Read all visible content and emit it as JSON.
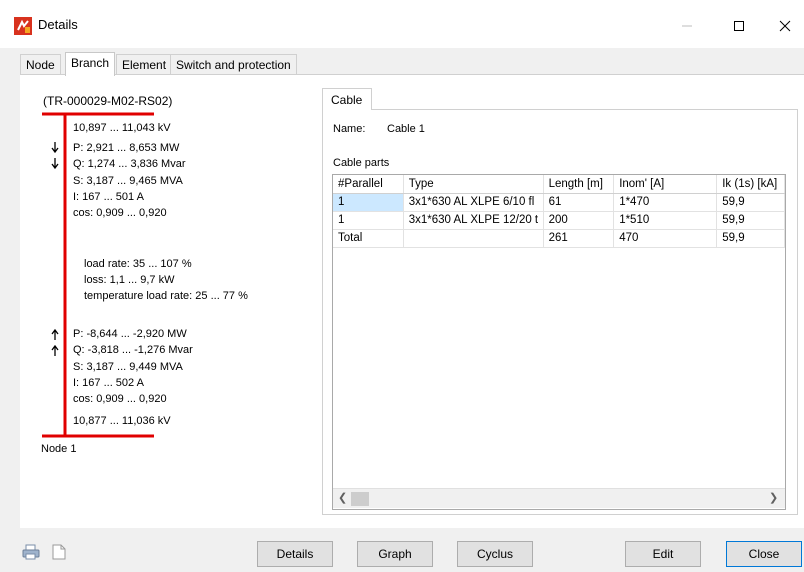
{
  "window": {
    "title": "Details"
  },
  "tabs": [
    "Node",
    "Branch",
    "Element",
    "Switch and protection"
  ],
  "branch": {
    "id": "(TR-000029-M02-RS02)",
    "top": {
      "voltage": "10,897 ... 11,043 kV",
      "p": "P: 2,921 ... 8,653 MW",
      "q": "Q: 1,274 ... 3,836 Mvar",
      "s": "S: 3,187 ... 9,465 MVA",
      "i": "I: 167 ... 501 A",
      "cos": "cos: 0,909 ... 0,920"
    },
    "middle": {
      "load_rate": "load rate: 35 ... 107 %",
      "loss": "loss: 1,1 ... 9,7 kW",
      "temp_load_rate": "temperature load rate: 25 ... 77 %"
    },
    "bottom": {
      "p": "P: -8,644 ... -2,920 MW",
      "q": "Q: -3,818 ... -1,276 Mvar",
      "s": "S: 3,187 ... 9,449 MVA",
      "i": "I: 167 ... 502 A",
      "cos": "cos: 0,909 ... 0,920",
      "voltage": "10,877 ... 11,036 kV"
    },
    "node_label": "Node 1"
  },
  "cable": {
    "tab": "Cable",
    "name_label": "Name:",
    "name_value": "Cable 1",
    "parts_label": "Cable parts",
    "columns": [
      "#Parallel",
      "Type",
      "Length [m]",
      "Inom' [A]",
      "Ik (1s) [kA]"
    ],
    "rows": [
      [
        "1",
        "3x1*630 AL XLPE  6/10 fl",
        "61",
        "1*470",
        "59,9"
      ],
      [
        "1",
        "3x1*630 AL XLPE 12/20 t",
        "200",
        "1*510",
        "59,9"
      ],
      [
        "Total",
        "",
        "261",
        "470",
        "59,9"
      ]
    ]
  },
  "buttons": {
    "details": "Details",
    "graph": "Graph",
    "cyclus": "Cyclus",
    "edit": "Edit",
    "close": "Close"
  },
  "colors": {
    "branch_line": "#e00000",
    "selection": "#cce8ff",
    "primary_border": "#0078d7"
  }
}
